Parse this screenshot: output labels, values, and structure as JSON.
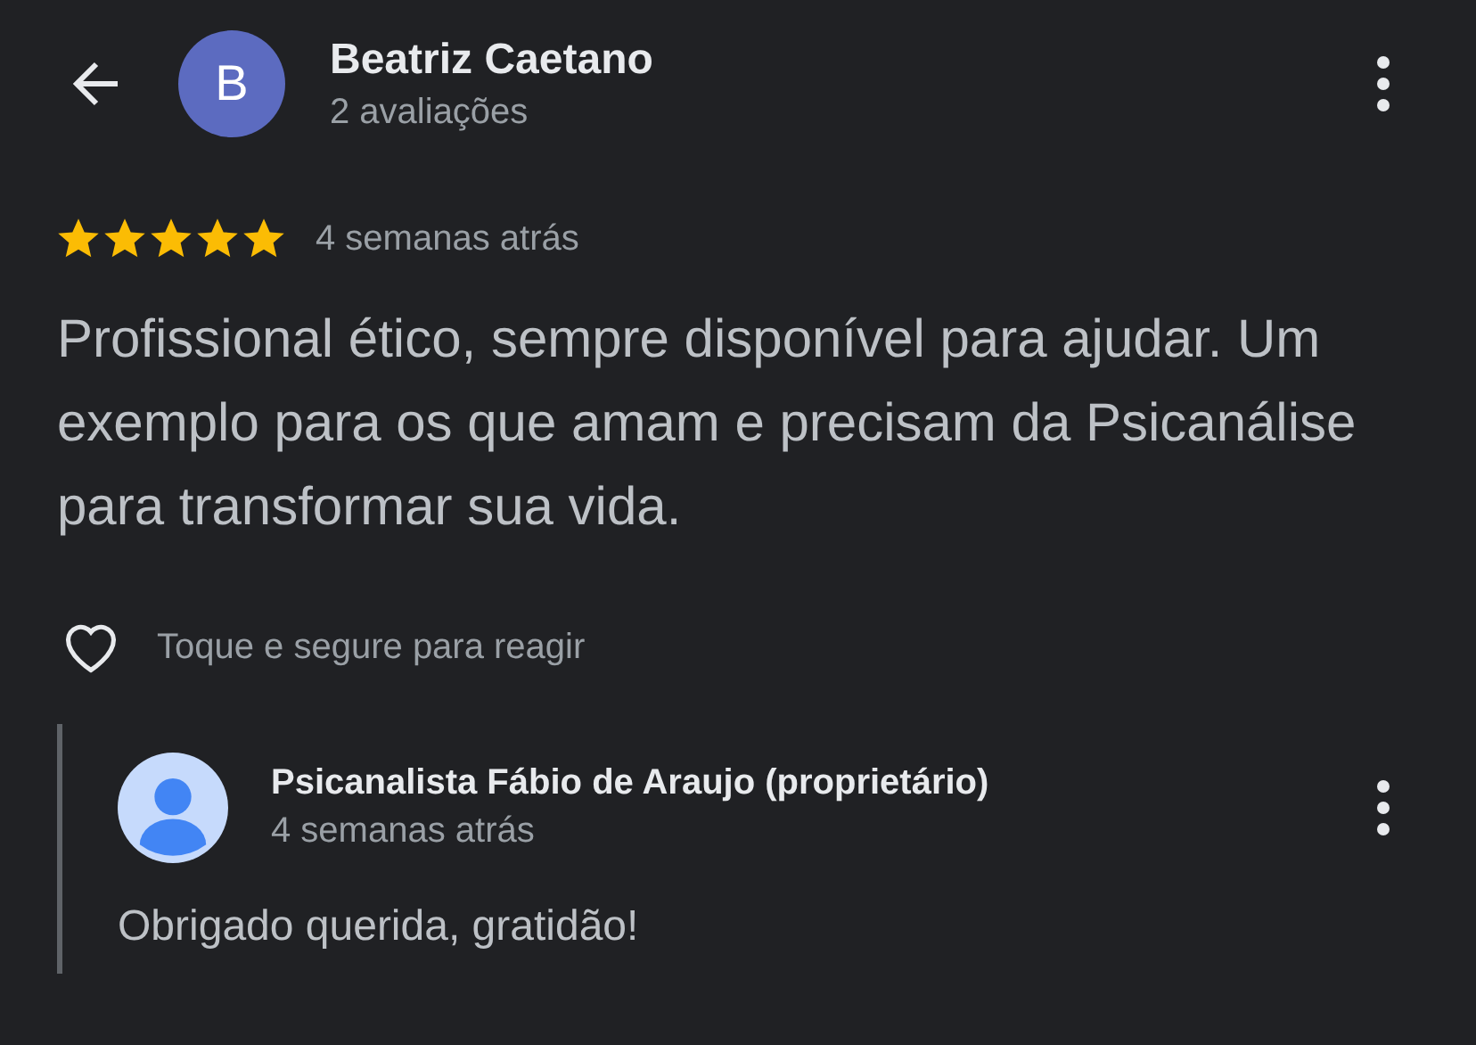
{
  "header": {
    "avatar_letter": "B",
    "name": "Beatriz Caetano",
    "subtitle": "2 avaliações"
  },
  "review": {
    "stars": 5,
    "time": "4 semanas atrás",
    "text": "Profissional ético, sempre disponível para ajudar. Um exemplo para os que amam e precisam da Psicanálise para transformar sua vida.",
    "reaction_hint": "Toque e segure para reagir",
    "liked": false
  },
  "reply": {
    "name": "Psicanalista Fábio de Araujo (proprietário)",
    "time": "4 semanas atrás",
    "text": "Obrigado querida, gratidão!"
  }
}
